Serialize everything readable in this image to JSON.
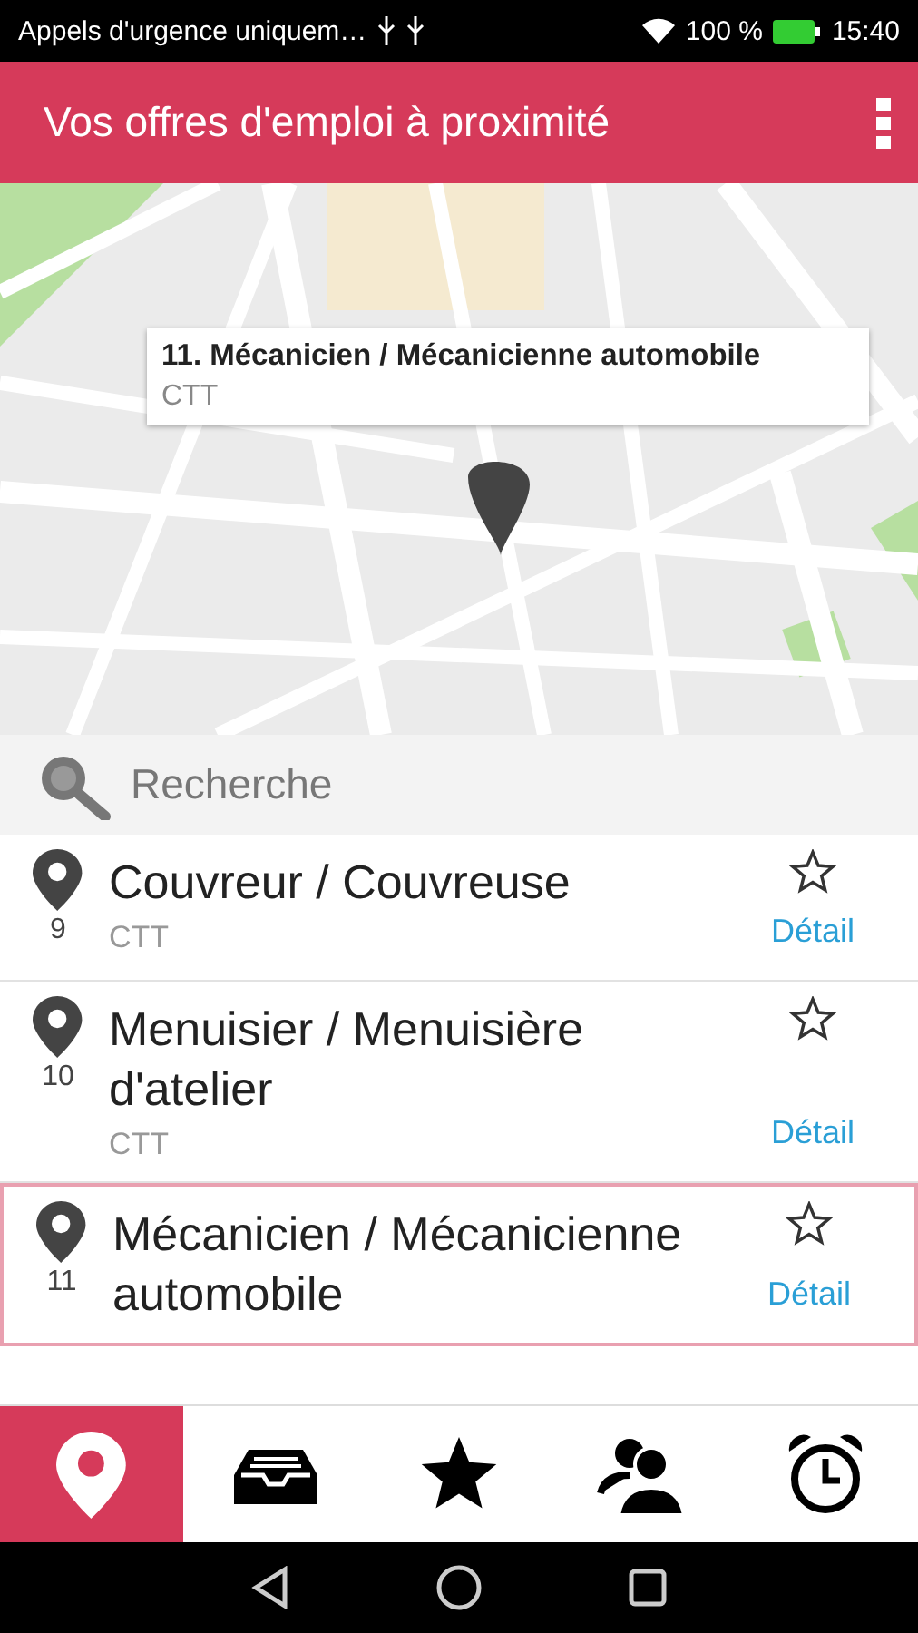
{
  "status_bar": {
    "carrier": "Appels d'urgence uniquem…",
    "battery": "100 %",
    "time": "15:40"
  },
  "app_bar": {
    "title": "Vos offres d'emploi à proximité"
  },
  "map": {
    "info_window": {
      "title": "11. Mécanicien / Mécanicienne automobile",
      "subtitle": "CTT"
    }
  },
  "search": {
    "placeholder": "Recherche"
  },
  "jobs": [
    {
      "number": "9",
      "title": "Couvreur / Couvreuse",
      "company": "CTT",
      "link": "Détail",
      "favorite": false,
      "selected": false
    },
    {
      "number": "10",
      "title": "Menuisier / Menuisière d'atelier",
      "company": "CTT",
      "link": "Détail",
      "favorite": false,
      "selected": false
    },
    {
      "number": "11",
      "title": "Mécanicien / Mécanicienne automobile",
      "link": "Détail",
      "favorite": false,
      "selected": true
    }
  ],
  "bottom_tabs": [
    {
      "kind": "map",
      "selected": true
    },
    {
      "kind": "inbox",
      "selected": false
    },
    {
      "kind": "favorites",
      "selected": false
    },
    {
      "kind": "contacts",
      "selected": false
    },
    {
      "kind": "alarm",
      "selected": false
    }
  ]
}
